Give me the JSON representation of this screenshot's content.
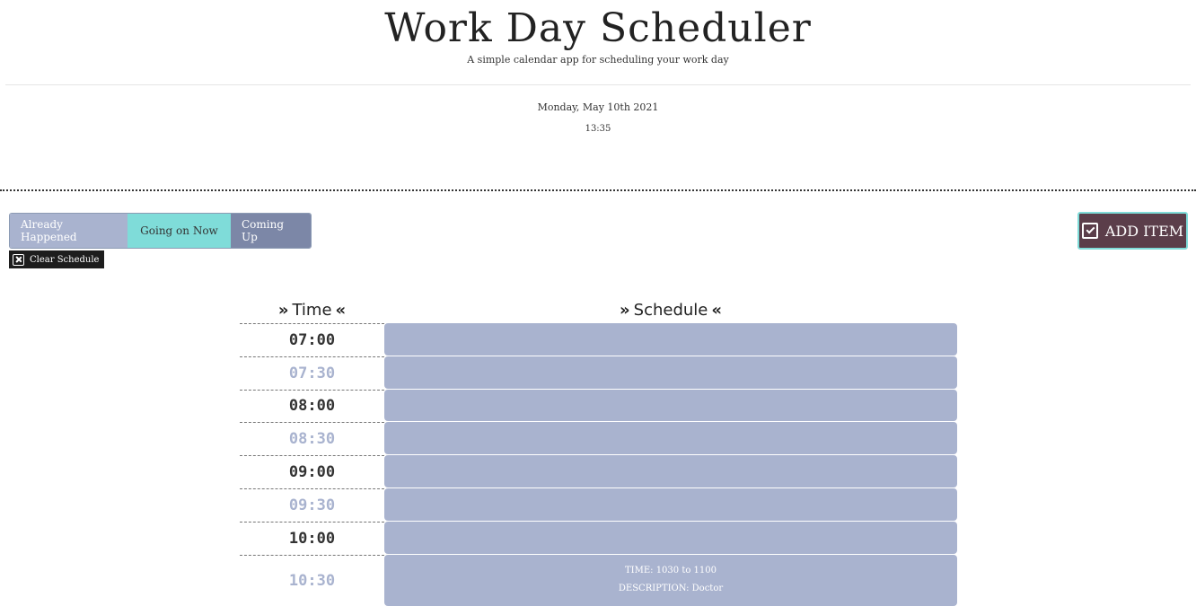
{
  "header": {
    "title": "Work Day Scheduler",
    "subtitle": "A simple calendar app for scheduling your work day",
    "date": "Monday, May 10th 2021",
    "clock": "13:35"
  },
  "legend": {
    "past": "Already Happened",
    "present": "Going on Now",
    "future": "Coming Up"
  },
  "buttons": {
    "clear": "Clear Schedule",
    "add": "ADD ITEM"
  },
  "table": {
    "time_header": "Time",
    "schedule_header": "Schedule",
    "rows": [
      {
        "time": "07:00",
        "entry_time": "",
        "entry_desc": ""
      },
      {
        "time": "07:30",
        "entry_time": "",
        "entry_desc": ""
      },
      {
        "time": "08:00",
        "entry_time": "",
        "entry_desc": ""
      },
      {
        "time": "08:30",
        "entry_time": "",
        "entry_desc": ""
      },
      {
        "time": "09:00",
        "entry_time": "",
        "entry_desc": ""
      },
      {
        "time": "09:30",
        "entry_time": "",
        "entry_desc": ""
      },
      {
        "time": "10:00",
        "entry_time": "",
        "entry_desc": ""
      },
      {
        "time": "10:30",
        "entry_time": "TIME: 1030 to 1100",
        "entry_desc": "DESCRIPTION: Doctor"
      }
    ]
  },
  "colors": {
    "past": "#a9b3cf",
    "present": "#7fdcd9",
    "future": "#7c87a7",
    "add_button": "#5b3e4a"
  },
  "icons": {
    "clear": "x-square-icon",
    "add": "calendar-check-icon",
    "chevrons_right": "chevrons-right-icon",
    "chevrons_left": "chevrons-left-icon"
  }
}
